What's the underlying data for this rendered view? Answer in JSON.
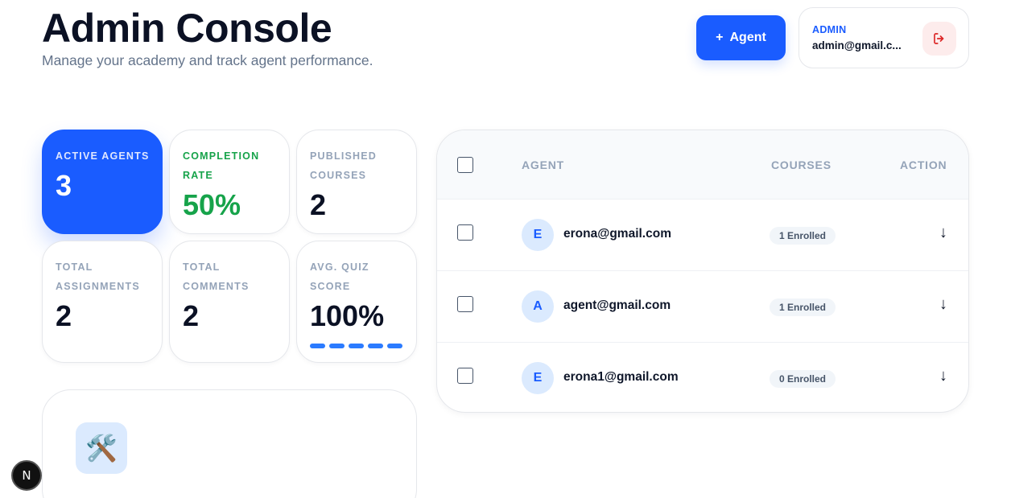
{
  "header": {
    "title": "Admin Console",
    "subtitle": "Manage your academy and track agent performance.",
    "add_button_icon": "+",
    "add_button_label": "Agent"
  },
  "user": {
    "role": "ADMIN",
    "email": "admin@gmail.c..."
  },
  "stats": [
    {
      "label": "ACTIVE AGENTS",
      "value": "3"
    },
    {
      "label": "COMPLETION RATE",
      "value": "50%"
    },
    {
      "label": "PUBLISHED COURSES",
      "value": "2"
    },
    {
      "label": "TOTAL ASSIGNMENTS",
      "value": "2"
    },
    {
      "label": "TOTAL COMMENTS",
      "value": "2"
    },
    {
      "label": "AVG. QUIZ SCORE",
      "value": "100%"
    }
  ],
  "quiz_score_fraction": 1.0,
  "tools_icon": "🛠️",
  "table": {
    "headers": {
      "agent": "AGENT",
      "courses": "COURSES",
      "action": "ACTION"
    },
    "rows": [
      {
        "initial": "E",
        "email": "erona@gmail.com",
        "enrolled": "1 Enrolled",
        "action": "↓"
      },
      {
        "initial": "A",
        "email": "agent@gmail.com",
        "enrolled": "1 Enrolled",
        "action": "↓"
      },
      {
        "initial": "E",
        "email": "erona1@gmail.com",
        "enrolled": "0 Enrolled",
        "action": "↓"
      }
    ]
  },
  "dev_indicator": "N",
  "colors": {
    "primary": "#1a5cff",
    "success": "#16a34a",
    "muted": "#94a3b8",
    "danger": "#dc2626"
  }
}
